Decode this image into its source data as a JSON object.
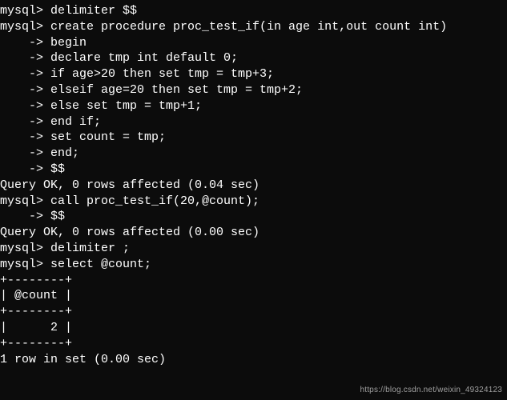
{
  "terminal": {
    "lines": [
      "mysql> delimiter $$",
      "mysql> create procedure proc_test_if(in age int,out count int)",
      "    -> begin",
      "    -> declare tmp int default 0;",
      "    -> if age>20 then set tmp = tmp+3;",
      "    -> elseif age=20 then set tmp = tmp+2;",
      "    -> else set tmp = tmp+1;",
      "    -> end if;",
      "    -> set count = tmp;",
      "    -> end;",
      "    -> $$",
      "Query OK, 0 rows affected (0.04 sec)",
      "",
      "mysql> call proc_test_if(20,@count);",
      "    -> $$",
      "Query OK, 0 rows affected (0.00 sec)",
      "",
      "mysql> delimiter ;",
      "mysql> select @count;",
      "+--------+",
      "| @count |",
      "+--------+",
      "|      2 |",
      "+--------+",
      "1 row in set (0.00 sec)"
    ]
  },
  "watermark": "https://blog.csdn.net/weixin_49324123"
}
